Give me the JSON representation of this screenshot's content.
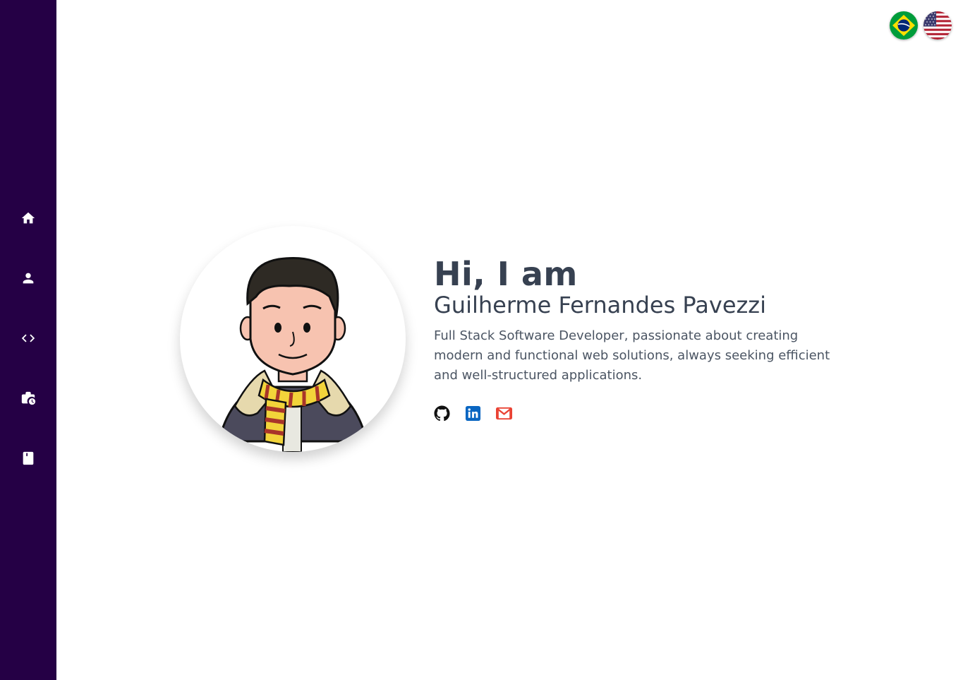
{
  "sidebar": {
    "background": "#250045",
    "items": [
      {
        "icon": "home-icon"
      },
      {
        "icon": "user-icon"
      },
      {
        "icon": "code-icon"
      },
      {
        "icon": "briefcase-clock-icon"
      },
      {
        "icon": "book-icon"
      }
    ]
  },
  "languages": [
    {
      "icon": "brazil-flag-icon"
    },
    {
      "icon": "usa-flag-icon"
    }
  ],
  "hero": {
    "greeting": "Hi, I am",
    "name": "Guilherme Fernandes Pavezzi",
    "bio": "Full Stack Software Developer, passionate about creating modern and functional web solutions, always seeking efficient and well-structured applications.",
    "avatar": "cartoon-avatar-illustration"
  },
  "socials": [
    {
      "icon": "github-icon"
    },
    {
      "icon": "linkedin-icon",
      "color": "#0a66c2"
    },
    {
      "icon": "gmail-icon",
      "color": "#ea4335"
    }
  ],
  "colors": {
    "text": "#374151",
    "muted": "#4b5563"
  }
}
